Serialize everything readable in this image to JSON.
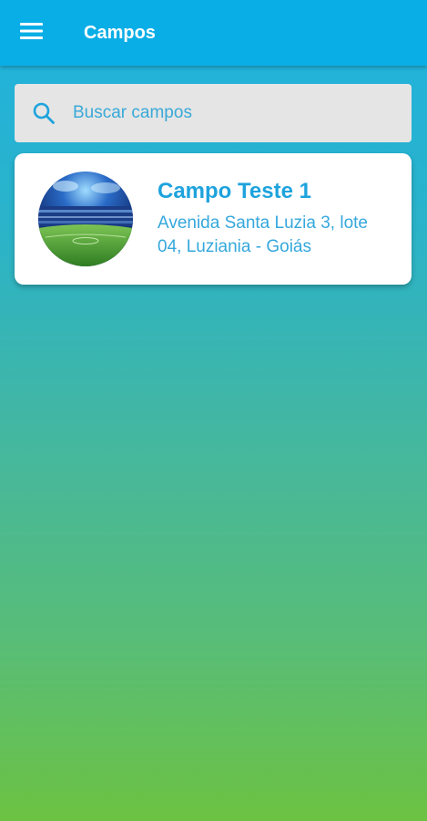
{
  "app_bar": {
    "title": "Campos",
    "menu_icon": "hamburger-menu-icon"
  },
  "search": {
    "placeholder": "Buscar campos",
    "value": "",
    "icon": "search-icon"
  },
  "fields": [
    {
      "name": "Campo Teste 1",
      "address": "Avenida Santa Luzia 3, lote 04, Luziania - Goiás",
      "image": "stadium-photo"
    }
  ],
  "colors": {
    "app_bar": "#0aaee6",
    "accent_text": "#1ea3dd",
    "gradient_top": "#1fb2e0",
    "gradient_bottom": "#6cc242"
  }
}
